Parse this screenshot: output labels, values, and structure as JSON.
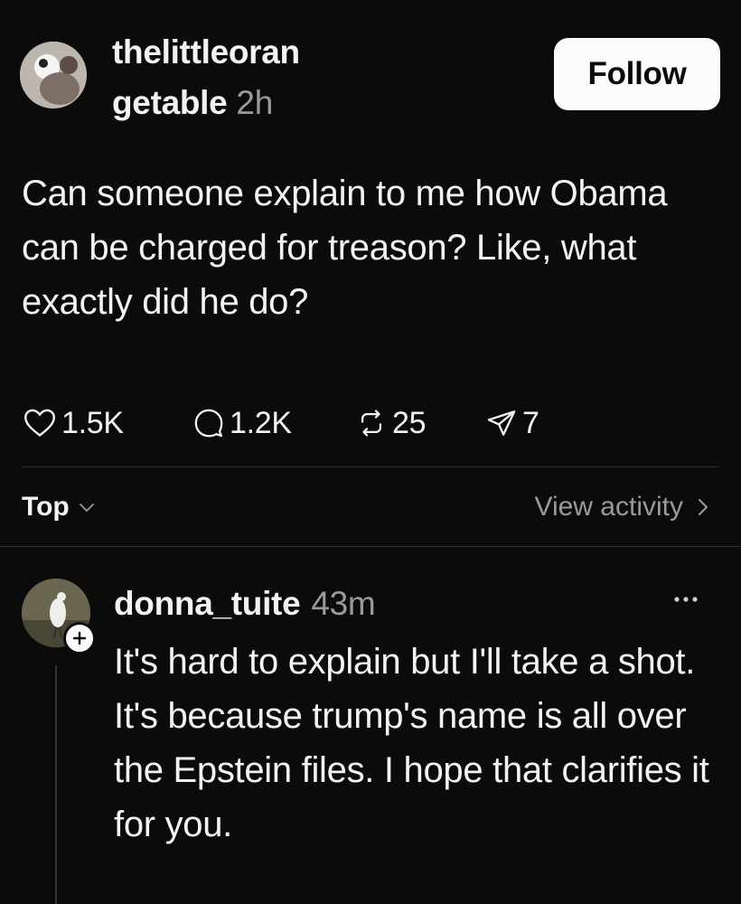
{
  "post": {
    "username_line1": "thelittleoran",
    "username_line2": "getable",
    "time": "2h",
    "follow_label": "Follow",
    "text": "Can someone explain to me how Obama can be charged for treason? Like, what exactly did he do?",
    "stats": {
      "likes": "1.5K",
      "comments": "1.2K",
      "reposts": "25",
      "shares": "7"
    }
  },
  "replies_bar": {
    "sort_label": "Top",
    "view_activity_label": "View activity"
  },
  "reply": {
    "username": "donna_tuite",
    "time": "43m",
    "text": "It's hard to explain but I'll take a shot. It's because trump's name is all over the Epstein files. I hope that clarifies it for you."
  },
  "icons": {
    "like": "heart-icon",
    "comment": "comment-icon",
    "repost": "repost-icon",
    "share": "share-icon",
    "sort": "chevron-down-icon",
    "view_activity": "chevron-right-icon",
    "more": "more-icon",
    "follow_reply_author": "plus-icon"
  },
  "colors": {
    "background": "#0b0b0b",
    "text": "#f3f3f3",
    "muted": "#9a9a9a",
    "button": "#fbfbfb"
  }
}
